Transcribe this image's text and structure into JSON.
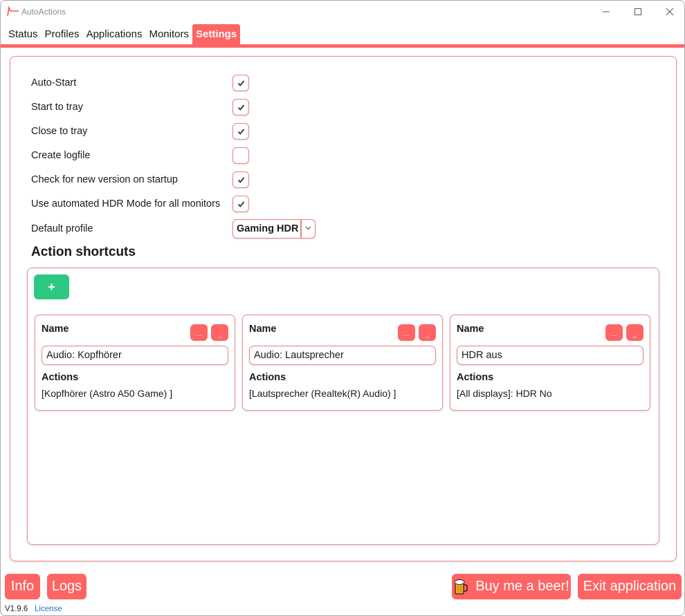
{
  "window": {
    "title": "AutoActions",
    "controls": [
      "minimize",
      "maximize",
      "close"
    ]
  },
  "tabs": [
    {
      "label": "Status",
      "active": false
    },
    {
      "label": "Profiles",
      "active": false
    },
    {
      "label": "Applications",
      "active": false
    },
    {
      "label": "Monitors",
      "active": false
    },
    {
      "label": "Settings",
      "active": true
    }
  ],
  "settings": {
    "auto_start": {
      "label": "Auto-Start",
      "checked": true
    },
    "start_to_tray": {
      "label": "Start to tray",
      "checked": true
    },
    "close_to_tray": {
      "label": "Close to tray",
      "checked": true
    },
    "create_logfile": {
      "label": "Create logfile",
      "checked": false
    },
    "check_new_version": {
      "label": "Check for new version on startup",
      "checked": true
    },
    "automated_hdr": {
      "label": "Use automated HDR Mode for all monitors",
      "checked": true
    },
    "default_profile": {
      "label": "Default profile",
      "value": "Gaming HDR"
    }
  },
  "action_shortcuts": {
    "heading": "Action shortcuts",
    "add_label": "+",
    "name_label": "Name",
    "actions_label": "Actions",
    "edit_label": "...",
    "remove_label": "_",
    "items": [
      {
        "name": "Audio: Kopfhörer",
        "actions": "[Kopfhörer (Astro A50 Game) ]"
      },
      {
        "name": "Audio: Lautsprecher",
        "actions": "[Lautsprecher (Realtek(R) Audio) ]"
      },
      {
        "name": "HDR aus",
        "actions": "[All displays]: HDR No"
      }
    ]
  },
  "footer": {
    "info_label": "Info",
    "logs_label": "Logs",
    "beer_label": "Buy me a beer!",
    "exit_label": "Exit application",
    "version": "V1.9.6",
    "license_label": "License"
  },
  "colors": {
    "accent": "#ff6464",
    "accent_border": "#f08a8a",
    "add_button": "#2ec883",
    "link": "#1e6fd0"
  }
}
